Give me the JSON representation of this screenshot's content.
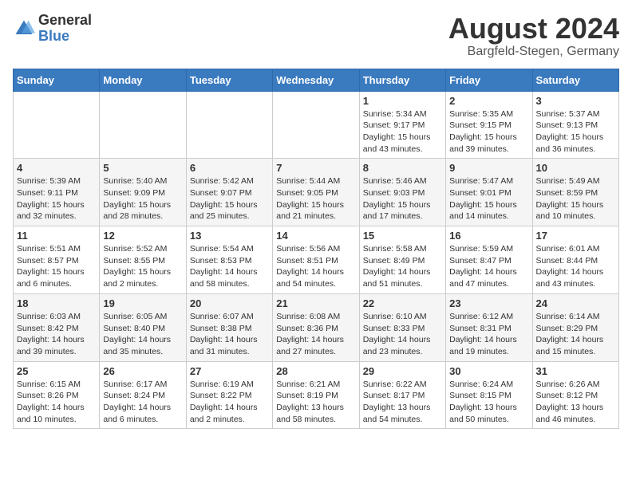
{
  "header": {
    "logo_general": "General",
    "logo_blue": "Blue",
    "month_title": "August 2024",
    "location": "Bargfeld-Stegen, Germany"
  },
  "days_of_week": [
    "Sunday",
    "Monday",
    "Tuesday",
    "Wednesday",
    "Thursday",
    "Friday",
    "Saturday"
  ],
  "weeks": [
    [
      {
        "day": "",
        "info": ""
      },
      {
        "day": "",
        "info": ""
      },
      {
        "day": "",
        "info": ""
      },
      {
        "day": "",
        "info": ""
      },
      {
        "day": "1",
        "info": "Sunrise: 5:34 AM\nSunset: 9:17 PM\nDaylight: 15 hours\nand 43 minutes."
      },
      {
        "day": "2",
        "info": "Sunrise: 5:35 AM\nSunset: 9:15 PM\nDaylight: 15 hours\nand 39 minutes."
      },
      {
        "day": "3",
        "info": "Sunrise: 5:37 AM\nSunset: 9:13 PM\nDaylight: 15 hours\nand 36 minutes."
      }
    ],
    [
      {
        "day": "4",
        "info": "Sunrise: 5:39 AM\nSunset: 9:11 PM\nDaylight: 15 hours\nand 32 minutes."
      },
      {
        "day": "5",
        "info": "Sunrise: 5:40 AM\nSunset: 9:09 PM\nDaylight: 15 hours\nand 28 minutes."
      },
      {
        "day": "6",
        "info": "Sunrise: 5:42 AM\nSunset: 9:07 PM\nDaylight: 15 hours\nand 25 minutes."
      },
      {
        "day": "7",
        "info": "Sunrise: 5:44 AM\nSunset: 9:05 PM\nDaylight: 15 hours\nand 21 minutes."
      },
      {
        "day": "8",
        "info": "Sunrise: 5:46 AM\nSunset: 9:03 PM\nDaylight: 15 hours\nand 17 minutes."
      },
      {
        "day": "9",
        "info": "Sunrise: 5:47 AM\nSunset: 9:01 PM\nDaylight: 15 hours\nand 14 minutes."
      },
      {
        "day": "10",
        "info": "Sunrise: 5:49 AM\nSunset: 8:59 PM\nDaylight: 15 hours\nand 10 minutes."
      }
    ],
    [
      {
        "day": "11",
        "info": "Sunrise: 5:51 AM\nSunset: 8:57 PM\nDaylight: 15 hours\nand 6 minutes."
      },
      {
        "day": "12",
        "info": "Sunrise: 5:52 AM\nSunset: 8:55 PM\nDaylight: 15 hours\nand 2 minutes."
      },
      {
        "day": "13",
        "info": "Sunrise: 5:54 AM\nSunset: 8:53 PM\nDaylight: 14 hours\nand 58 minutes."
      },
      {
        "day": "14",
        "info": "Sunrise: 5:56 AM\nSunset: 8:51 PM\nDaylight: 14 hours\nand 54 minutes."
      },
      {
        "day": "15",
        "info": "Sunrise: 5:58 AM\nSunset: 8:49 PM\nDaylight: 14 hours\nand 51 minutes."
      },
      {
        "day": "16",
        "info": "Sunrise: 5:59 AM\nSunset: 8:47 PM\nDaylight: 14 hours\nand 47 minutes."
      },
      {
        "day": "17",
        "info": "Sunrise: 6:01 AM\nSunset: 8:44 PM\nDaylight: 14 hours\nand 43 minutes."
      }
    ],
    [
      {
        "day": "18",
        "info": "Sunrise: 6:03 AM\nSunset: 8:42 PM\nDaylight: 14 hours\nand 39 minutes."
      },
      {
        "day": "19",
        "info": "Sunrise: 6:05 AM\nSunset: 8:40 PM\nDaylight: 14 hours\nand 35 minutes."
      },
      {
        "day": "20",
        "info": "Sunrise: 6:07 AM\nSunset: 8:38 PM\nDaylight: 14 hours\nand 31 minutes."
      },
      {
        "day": "21",
        "info": "Sunrise: 6:08 AM\nSunset: 8:36 PM\nDaylight: 14 hours\nand 27 minutes."
      },
      {
        "day": "22",
        "info": "Sunrise: 6:10 AM\nSunset: 8:33 PM\nDaylight: 14 hours\nand 23 minutes."
      },
      {
        "day": "23",
        "info": "Sunrise: 6:12 AM\nSunset: 8:31 PM\nDaylight: 14 hours\nand 19 minutes."
      },
      {
        "day": "24",
        "info": "Sunrise: 6:14 AM\nSunset: 8:29 PM\nDaylight: 14 hours\nand 15 minutes."
      }
    ],
    [
      {
        "day": "25",
        "info": "Sunrise: 6:15 AM\nSunset: 8:26 PM\nDaylight: 14 hours\nand 10 minutes."
      },
      {
        "day": "26",
        "info": "Sunrise: 6:17 AM\nSunset: 8:24 PM\nDaylight: 14 hours\nand 6 minutes."
      },
      {
        "day": "27",
        "info": "Sunrise: 6:19 AM\nSunset: 8:22 PM\nDaylight: 14 hours\nand 2 minutes."
      },
      {
        "day": "28",
        "info": "Sunrise: 6:21 AM\nSunset: 8:19 PM\nDaylight: 13 hours\nand 58 minutes."
      },
      {
        "day": "29",
        "info": "Sunrise: 6:22 AM\nSunset: 8:17 PM\nDaylight: 13 hours\nand 54 minutes."
      },
      {
        "day": "30",
        "info": "Sunrise: 6:24 AM\nSunset: 8:15 PM\nDaylight: 13 hours\nand 50 minutes."
      },
      {
        "day": "31",
        "info": "Sunrise: 6:26 AM\nSunset: 8:12 PM\nDaylight: 13 hours\nand 46 minutes."
      }
    ]
  ]
}
